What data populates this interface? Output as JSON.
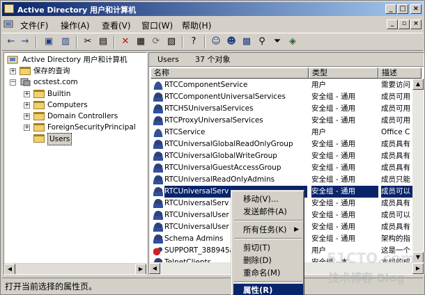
{
  "window": {
    "title": "Active Directory 用户和计算机"
  },
  "menubar": {
    "items": [
      "文件(F)",
      "操作(A)",
      "查看(V)",
      "窗口(W)",
      "帮助(H)"
    ]
  },
  "tree": {
    "root": "Active Directory 用户和计算机",
    "saved_queries": "保存的查询",
    "domain": "ocstest.com",
    "children": [
      "Builtin",
      "Computers",
      "Domain Controllers",
      "ForeignSecurityPrincipal",
      "Users"
    ]
  },
  "list": {
    "folder": "Users",
    "count": "37 个对象",
    "columns": [
      "名称",
      "类型",
      "描述"
    ],
    "rows": [
      {
        "name": "RTCComponentService",
        "type": "用户",
        "desc": "需要访问",
        "icon": "user"
      },
      {
        "name": "RTCComponentUniversalServices",
        "type": "安全组 - 通用",
        "desc": "成员可用",
        "icon": "group"
      },
      {
        "name": "RTCHSUniversalServices",
        "type": "安全组 - 通用",
        "desc": "成员可用",
        "icon": "group"
      },
      {
        "name": "RTCProxyUniversalServices",
        "type": "安全组 - 通用",
        "desc": "成员可用",
        "icon": "group"
      },
      {
        "name": "RTCService",
        "type": "用户",
        "desc": "Office C",
        "icon": "user"
      },
      {
        "name": "RTCUniversalGlobalReadOnlyGroup",
        "type": "安全组 - 通用",
        "desc": "成员具有",
        "icon": "group"
      },
      {
        "name": "RTCUniversalGlobalWriteGroup",
        "type": "安全组 - 通用",
        "desc": "成员具有",
        "icon": "group"
      },
      {
        "name": "RTCUniversalGuestAccessGroup",
        "type": "安全组 - 通用",
        "desc": "成员具有",
        "icon": "group"
      },
      {
        "name": "RTCUniversalReadOnlyAdmins",
        "type": "安全组 - 通用",
        "desc": "成员只能",
        "icon": "group"
      },
      {
        "name": "RTCUniversalServ",
        "type": "安全组 - 通用",
        "desc": "成员可以",
        "icon": "group"
      },
      {
        "name": "RTCUniversalServ",
        "type": "安全组 - 通用",
        "desc": "成员具有",
        "icon": "group"
      },
      {
        "name": "RTCUniversalUser",
        "type": "安全组 - 通用",
        "desc": "成员可以",
        "icon": "group"
      },
      {
        "name": "RTCUniversalUser",
        "type": "安全组 - 通用",
        "desc": "成员具有",
        "icon": "group"
      },
      {
        "name": "Schema Admins",
        "type": "安全组 - 通用",
        "desc": "架构的指",
        "icon": "group"
      },
      {
        "name": "SUPPORT_388945a0",
        "type": "用户",
        "desc": "这是一个",
        "icon": "error-user"
      },
      {
        "name": "TelnetClients",
        "type": "安全组 - 本...",
        "desc": "本组的成",
        "icon": "group"
      }
    ],
    "selected_index": 9
  },
  "context_menu": {
    "items": [
      "移动(V)...",
      "发送邮件(A)",
      "所有任务(K)",
      "剪切(T)",
      "删除(D)",
      "重命名(M)",
      "属性(R)"
    ],
    "highlighted": "属性(R)"
  },
  "status": {
    "text": "打开当前选择的属性页。"
  },
  "watermark": {
    "line1": "51CTO.com",
    "line2": "技术博客 Blog"
  },
  "colors": {
    "title_start": "#0a246a",
    "title_end": "#a6caf0",
    "selection": "#0a246a",
    "chrome": "#d4d0c8"
  }
}
